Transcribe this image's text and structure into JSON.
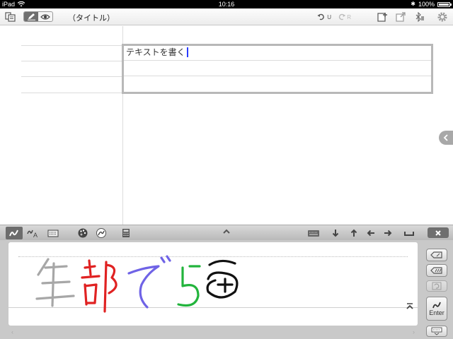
{
  "status_bar": {
    "device": "iPad",
    "time": "10:16",
    "battery": "100%",
    "battery_level_percent": 100
  },
  "toolbar": {
    "doc_title": "（タイトル）",
    "undo_sub": "U",
    "redo_sub": "R",
    "icons": [
      "document-list-icon",
      "pen-mode-icon",
      "view-mode-icon",
      "undo-icon",
      "redo-icon",
      "add-page-icon",
      "export-icon",
      "bluetooth-icon",
      "settings-gear-icon"
    ]
  },
  "table": {
    "cell_text": "テキストを書く",
    "caret_color": "#2a3cff"
  },
  "ime_bar": {
    "icons": [
      "handwriting-mode-icon",
      "handwriting-to-text-icon",
      "keyboard-mode-icon",
      "palette-icon",
      "pen-stroke-icon",
      "calculator-icon",
      "collapse-up-icon",
      "keyboard-toggle-icon",
      "arrow-down-icon",
      "arrow-up-icon",
      "arrow-left-icon",
      "arrow-right-icon",
      "space-icon",
      "close-keyboard-icon"
    ]
  },
  "handwriting": {
    "stroke_colors": [
      "#a7a7a7",
      "#e02222",
      "#6f63e6",
      "#22b43c",
      "#111111"
    ],
    "scroll_left": "‹",
    "scroll_right": "›"
  },
  "side_keys": {
    "enter_label": "Enter"
  }
}
